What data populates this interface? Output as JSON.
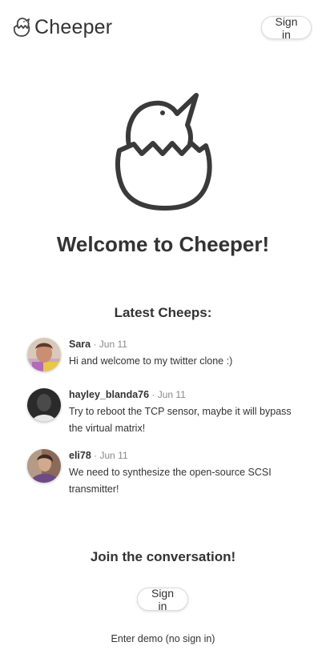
{
  "header": {
    "logo_text": "Cheeper",
    "sign_in_label": "Sign in"
  },
  "hero": {
    "welcome_text": "Welcome to Cheeper!"
  },
  "latest": {
    "title": "Latest Cheeps:",
    "cheeps": [
      {
        "username": "Sara",
        "separator": " · ",
        "date": "Jun 11",
        "text": "Hi and welcome to my twitter clone :)",
        "avatar_icon": "user-avatar-photo"
      },
      {
        "username": "hayley_blanda76",
        "separator": " · ",
        "date": "Jun 11",
        "text": "Try to reboot the TCP sensor, maybe it will bypass the virtual matrix!",
        "avatar_icon": "user-avatar-photo"
      },
      {
        "username": "eli78",
        "separator": " · ",
        "date": "Jun 11",
        "text": "We need to synthesize the open-source SCSI transmitter!",
        "avatar_icon": "user-avatar-photo"
      }
    ]
  },
  "join": {
    "title": "Join the conversation!",
    "sign_in_label": "Sign in",
    "demo_label": "Enter demo (no sign in)"
  },
  "colors": {
    "text": "#333333",
    "muted": "#888888",
    "border": "#dcdcdc",
    "background": "#ffffff"
  }
}
